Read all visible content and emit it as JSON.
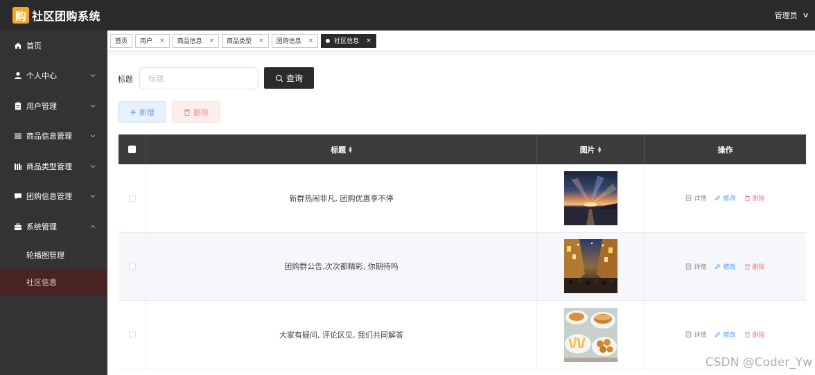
{
  "header": {
    "logo_char": "购",
    "title": "社区团购系统",
    "user": "管理员"
  },
  "sidebar": {
    "items": [
      {
        "label": "首页"
      },
      {
        "label": "个人中心"
      },
      {
        "label": "用户管理"
      },
      {
        "label": "商品信息管理"
      },
      {
        "label": "商品类型管理"
      },
      {
        "label": "团购信息管理"
      },
      {
        "label": "系统管理"
      }
    ],
    "sub_items": [
      {
        "label": "轮播图管理"
      },
      {
        "label": "社区信息"
      }
    ]
  },
  "tabs": [
    {
      "label": "首页"
    },
    {
      "label": "用户"
    },
    {
      "label": "商品信息"
    },
    {
      "label": "商品类型"
    },
    {
      "label": "团购信息"
    },
    {
      "label": "社区信息"
    }
  ],
  "tab_close": "×",
  "search": {
    "label": "标题",
    "placeholder": "标题",
    "button": "查询"
  },
  "actions": {
    "add": "新增",
    "delete": "删除"
  },
  "table": {
    "columns": {
      "title": "标题",
      "image": "图片",
      "ops": "操作"
    },
    "ops": {
      "detail": "详情",
      "edit": "修改",
      "delete": "删除"
    },
    "rows": [
      {
        "title": "新群热闹非凡, 团购优惠享不停"
      },
      {
        "title": "团购群公告,次次都精彩, 你期待吗"
      },
      {
        "title": "大家有疑问, 评论区见, 我们共同解答"
      }
    ]
  },
  "watermark": "CSDN @Coder_Yw"
}
